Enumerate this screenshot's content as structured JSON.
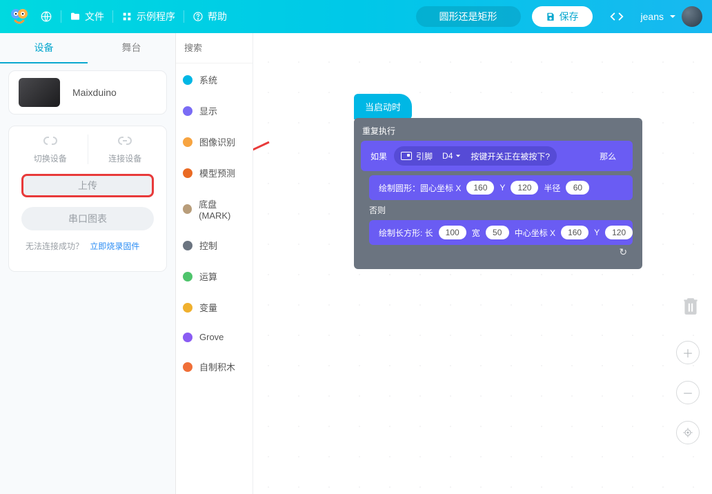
{
  "topbar": {
    "file": "文件",
    "examples": "示例程序",
    "help": "帮助",
    "project_name": "圆形还是矩形",
    "save": "保存",
    "username": "jeans"
  },
  "sidebar": {
    "tab_device": "设备",
    "tab_stage": "舞台",
    "device_name": "Maixduino",
    "switch_device": "切换设备",
    "connect_device": "连接设备",
    "upload": "上传",
    "serial_chart": "串口图表",
    "hint_text": "无法连接成功？",
    "hint_link": "立即烧录固件"
  },
  "search": {
    "placeholder": "搜索"
  },
  "categories": [
    {
      "label": "系统",
      "color": "#00b7e5"
    },
    {
      "label": "显示",
      "color": "#7a6cf5"
    },
    {
      "label": "图像识别",
      "color": "#f7a441"
    },
    {
      "label": "模型预测",
      "color": "#ea6a23"
    },
    {
      "label": "底盘(MARK)",
      "color": "#b89d7a"
    },
    {
      "label": "控制",
      "color": "#6b7480"
    },
    {
      "label": "运算",
      "color": "#4fc46c"
    },
    {
      "label": "变量",
      "color": "#f0b02e"
    },
    {
      "label": "Grove",
      "color": "#8a5cf3"
    },
    {
      "label": "自制积木",
      "color": "#f06f38"
    }
  ],
  "blocks": {
    "start": "当启动时",
    "repeat": "重复执行",
    "if": "如果",
    "pin": "引脚",
    "pin_value": "D4",
    "pressed": "按键开关正在被按下?",
    "then": "那么",
    "draw_circle": "绘制圆形：圆心坐标 X",
    "cx": "160",
    "cy_label": "Y",
    "cy": "120",
    "radius_label": "半径",
    "radius": "60",
    "else": "否则",
    "draw_rect": "绘制长方形: 长",
    "rw": "100",
    "rh_label": "宽",
    "rh": "50",
    "center_label": "中心坐标 X",
    "rx": "160",
    "ry_label": "Y",
    "ry": "120"
  }
}
